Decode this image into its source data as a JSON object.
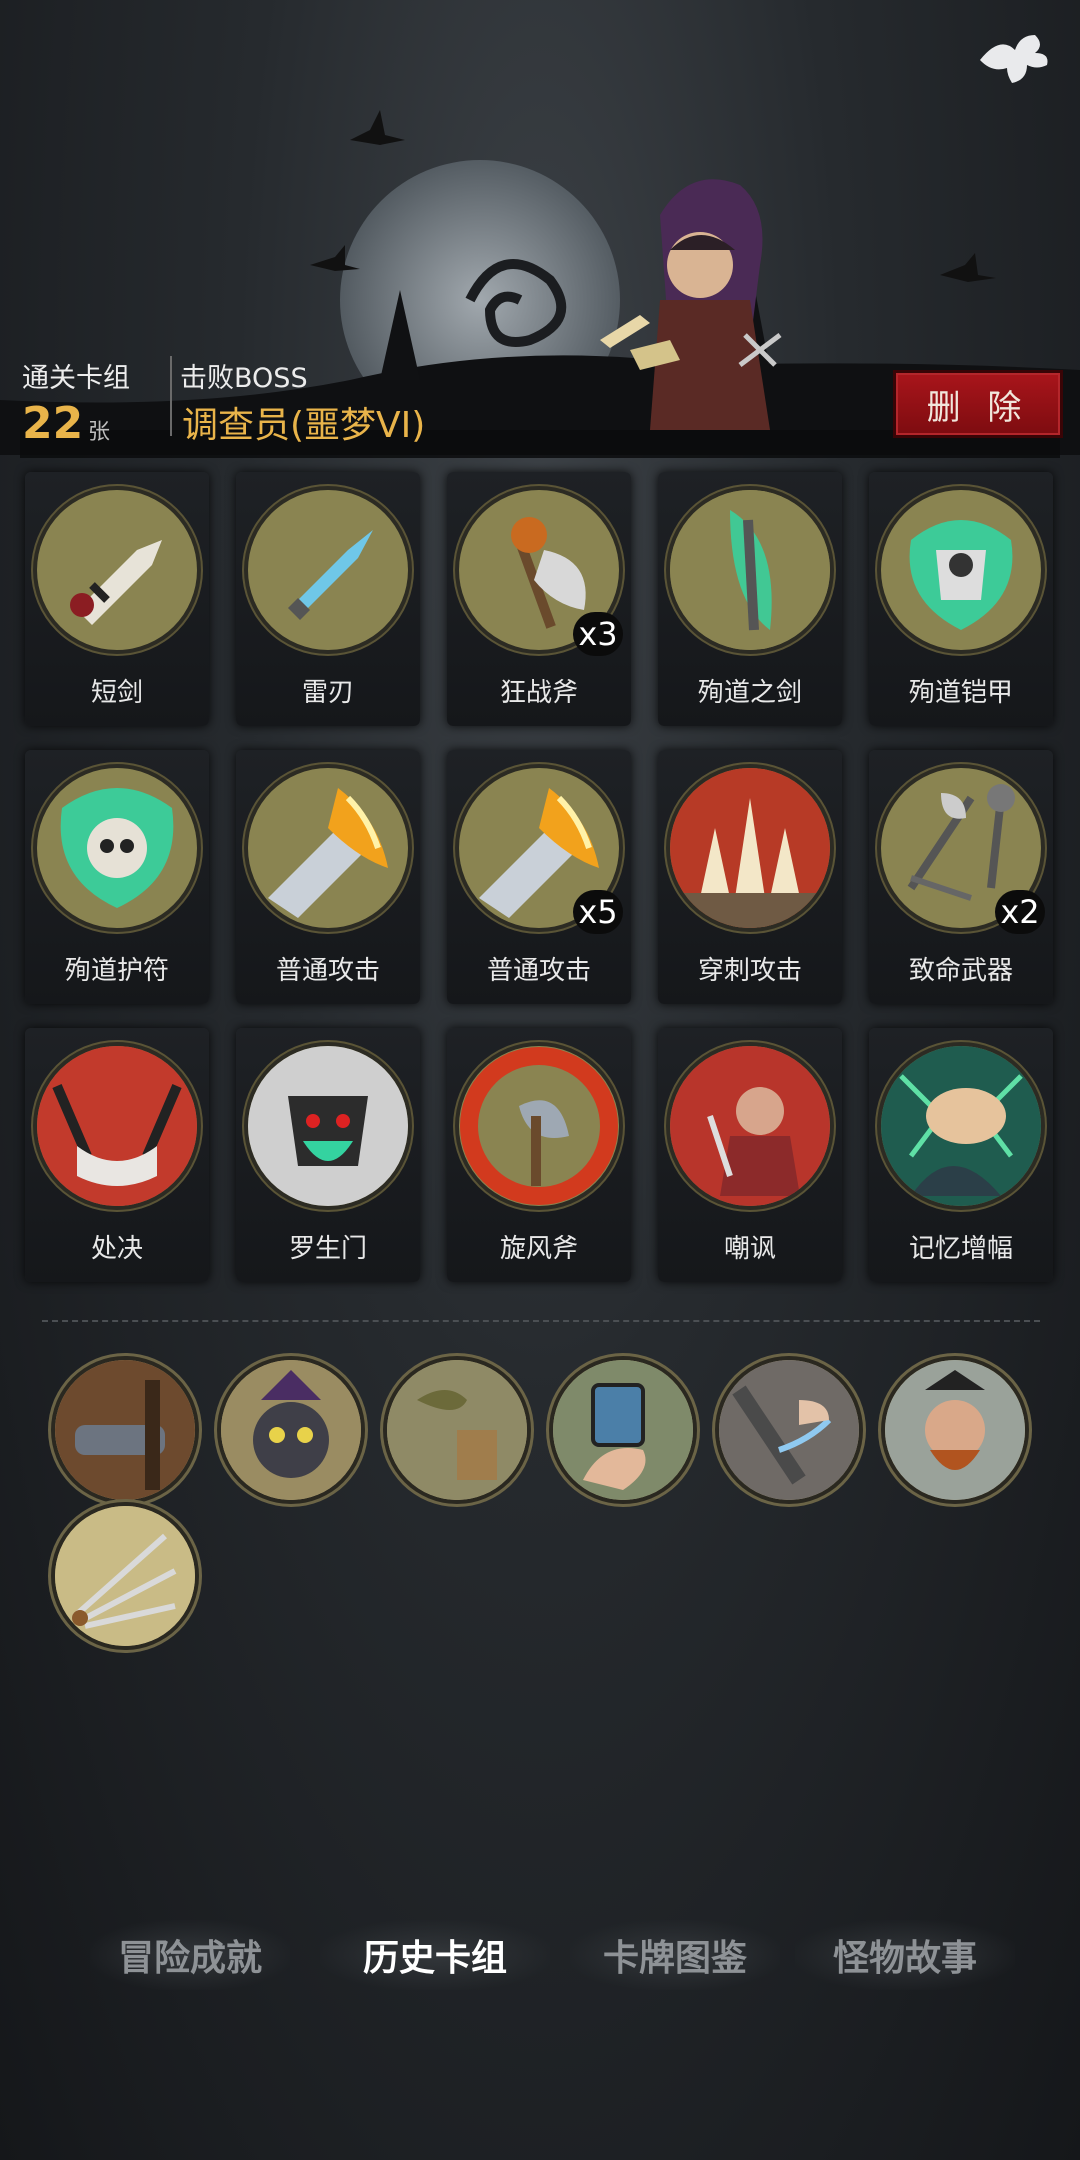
{
  "header": {
    "deck_label": "通关卡组",
    "deck_count": "22",
    "deck_unit": "张",
    "boss_label": "击败BOSS",
    "boss_name": "调查员(噩梦VI)",
    "delete_label": "删 除"
  },
  "cards": [
    {
      "name": "短剑",
      "badge": "",
      "icon": "dagger-icon"
    },
    {
      "name": "雷刃",
      "badge": "",
      "icon": "blue-blade-icon"
    },
    {
      "name": "狂战斧",
      "badge": "x3",
      "icon": "battle-axe-icon"
    },
    {
      "name": "殉道之剑",
      "badge": "",
      "icon": "ghost-sword-icon"
    },
    {
      "name": "殉道铠甲",
      "badge": "",
      "icon": "ghost-armor-icon"
    },
    {
      "name": "殉道护符",
      "badge": "",
      "icon": "skull-amulet-icon"
    },
    {
      "name": "普通攻击",
      "badge": "",
      "icon": "flaming-sword-icon"
    },
    {
      "name": "普通攻击",
      "badge": "x5",
      "icon": "flaming-sword-icon"
    },
    {
      "name": "穿刺攻击",
      "badge": "",
      "icon": "spikes-icon"
    },
    {
      "name": "致命武器",
      "badge": "x2",
      "icon": "weapons-icon"
    },
    {
      "name": "处决",
      "badge": "",
      "icon": "execution-icon"
    },
    {
      "name": "罗生门",
      "badge": "",
      "icon": "demon-gate-icon"
    },
    {
      "name": "旋风斧",
      "badge": "",
      "icon": "whirlwind-axe-icon"
    },
    {
      "name": "嘲讽",
      "badge": "",
      "icon": "taunt-icon"
    },
    {
      "name": "记忆增幅",
      "badge": "",
      "icon": "brain-icon"
    }
  ],
  "relics": [
    {
      "icon": "cannon-relic-icon"
    },
    {
      "icon": "witch-cat-relic-icon"
    },
    {
      "icon": "bird-relic-icon"
    },
    {
      "icon": "card-hand-relic-icon"
    },
    {
      "icon": "slash-hand-relic-icon"
    },
    {
      "icon": "pirate-relic-icon"
    },
    {
      "icon": "throwing-knives-relic-icon"
    }
  ],
  "tabs": [
    {
      "label": "冒险成就",
      "active": false
    },
    {
      "label": "历史卡组",
      "active": true
    },
    {
      "label": "卡牌图鉴",
      "active": false
    },
    {
      "label": "怪物故事",
      "active": false
    }
  ],
  "colors": {
    "accent_gold": "#e9b44a",
    "delete_red": "#a9151b",
    "disc_olive": "#8a8451"
  }
}
